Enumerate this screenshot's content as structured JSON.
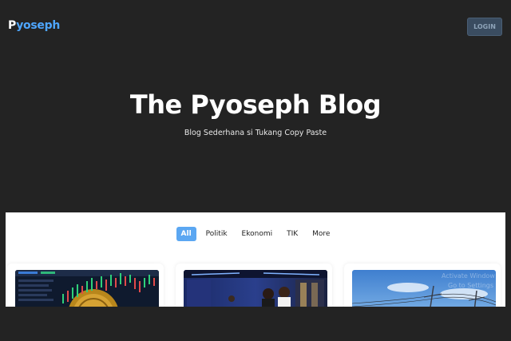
{
  "nav": {
    "brand_first": "P",
    "brand_rest": "yoseph",
    "login_label": "LOGIN"
  },
  "hero": {
    "title": "The Pyoseph Blog",
    "subtitle": "Blog Sederhana si Tukang Copy Paste"
  },
  "tabs": [
    {
      "label": "All",
      "active": true
    },
    {
      "label": "Politik",
      "active": false
    },
    {
      "label": "Ekonomi",
      "active": false
    },
    {
      "label": "TIK",
      "active": false
    },
    {
      "label": "More",
      "active": false
    }
  ],
  "watermark": {
    "line1": "Activate Window",
    "line2": "Go to Settings to act"
  },
  "colors": {
    "background": "#232323",
    "accent": "#5ba7f2",
    "brand_blue": "#4ea6ff",
    "login_bg": "#3a4c60"
  }
}
